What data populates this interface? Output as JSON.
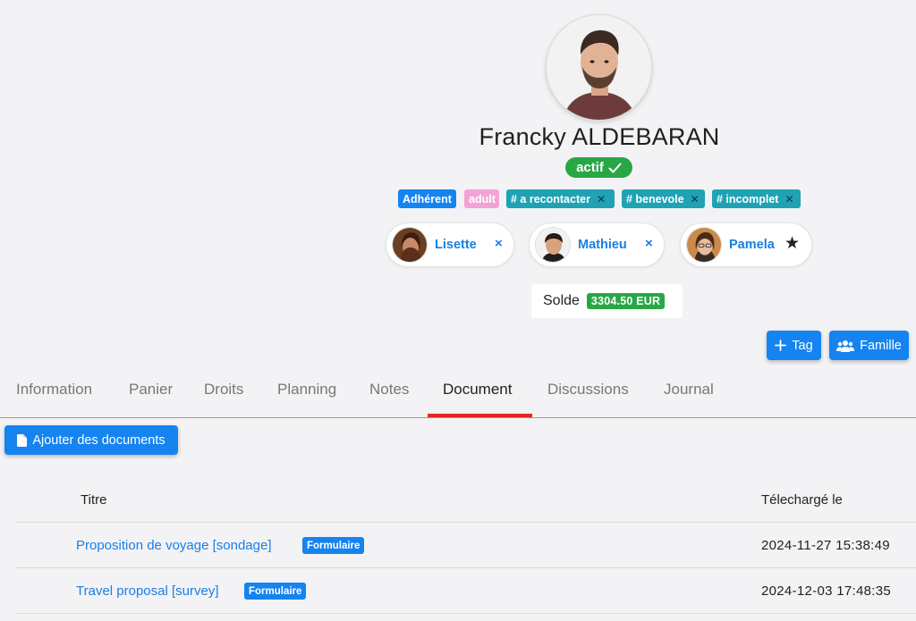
{
  "profile": {
    "name": "Francky ALDEBARAN",
    "status": "actif"
  },
  "tags": [
    {
      "label": "Adhérent",
      "color": "#1583f0",
      "removable": false
    },
    {
      "label": "adult",
      "color": "#f3a3d3",
      "removable": false
    },
    {
      "label": "# a recontacter",
      "color": "#1fa2b4",
      "removable": true
    },
    {
      "label": "# benevole",
      "color": "#1fa2b4",
      "removable": true
    },
    {
      "label": "# incomplet",
      "color": "#1fa2b4",
      "removable": true
    }
  ],
  "family": [
    {
      "name": "Lisette",
      "action": "×"
    },
    {
      "name": "Mathieu",
      "action": "×"
    },
    {
      "name": "Pamela",
      "action": "★"
    }
  ],
  "balance": {
    "label": "Solde",
    "value": "3304.50 EUR"
  },
  "actions": {
    "tag_label": "Tag",
    "family_label": "Famille"
  },
  "tabs": [
    "Information",
    "Panier",
    "Droits",
    "Planning",
    "Notes",
    "Document",
    "Discussions",
    "Journal"
  ],
  "active_tab": "Document",
  "documents": {
    "add_label": "Ajouter des documents",
    "col_title": "Titre",
    "col_date": "Télechargé le",
    "rows": [
      {
        "title": "Proposition de voyage [sondage]",
        "badge": "Formulaire",
        "date": "2024-11-27 15:38:49"
      },
      {
        "title": "Travel proposal [survey]",
        "badge": "Formulaire",
        "date": "2024-12-03 17:48:35"
      }
    ]
  },
  "colors": {
    "primary": "#1583f0",
    "success": "#28a745",
    "info": "#1fa2b4",
    "pink": "#f3a3d3",
    "active_tab_underline": "#e02626"
  }
}
